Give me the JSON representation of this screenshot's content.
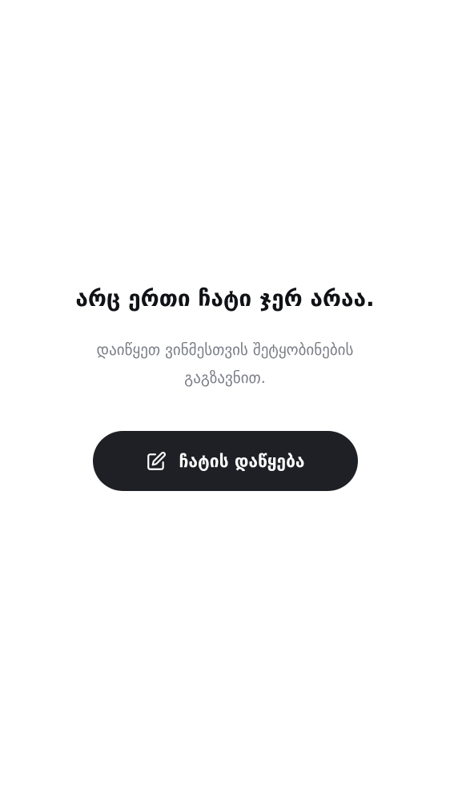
{
  "empty_state": {
    "title": "არც ერთი ჩატი ჯერ არაა.",
    "subtitle": "დაიწყეთ ვინმესთვის შეტყობინების გაგზავნით.",
    "start_button": {
      "label": "ჩატის დაწყება",
      "icon": "edit-icon"
    }
  },
  "colors": {
    "background": "#ffffff",
    "title": "#111216",
    "subtitle": "#7a7d85",
    "button_bg": "#1f2025",
    "button_text": "#ffffff"
  }
}
